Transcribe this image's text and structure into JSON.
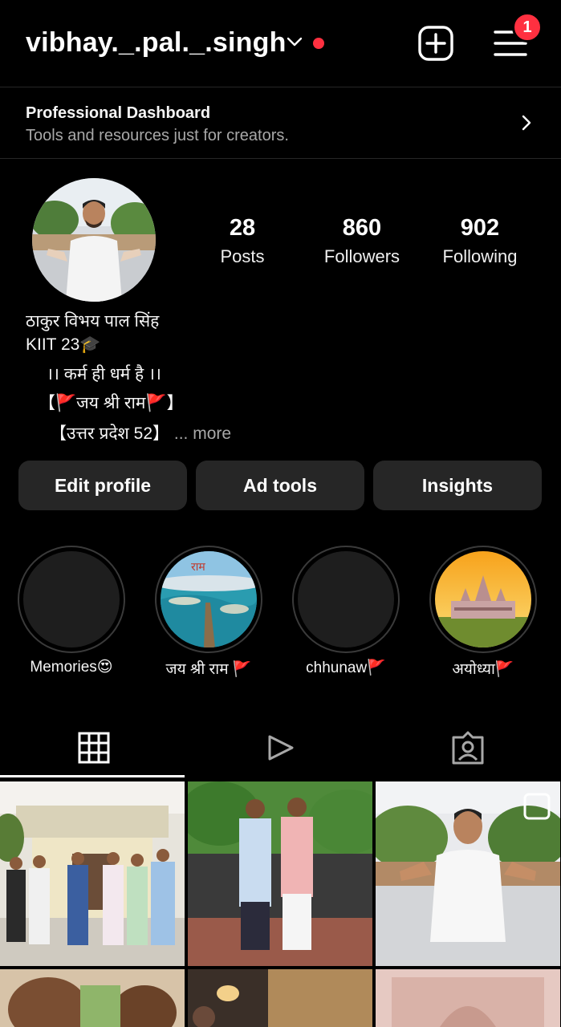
{
  "header": {
    "username": "vibhay._.pal._.singh",
    "notification_count": "1",
    "icons": [
      "chevron-down-icon",
      "create-plus-icon",
      "menu-icon"
    ],
    "colors": {
      "live_dot": "#ff3040",
      "badge": "#ff3040"
    }
  },
  "dashboard": {
    "title": "Professional Dashboard",
    "subtitle": "Tools and resources just for creators."
  },
  "profile": {
    "stats": [
      {
        "value": "28",
        "label": "Posts"
      },
      {
        "value": "860",
        "label": "Followers"
      },
      {
        "value": "902",
        "label": "Following"
      }
    ],
    "bio": {
      "line1": "ठाकुर विभय पाल सिंह",
      "line2": "KIIT 23🎓",
      "line3": "।। कर्म ही धर्म है ।।",
      "line4": "【🚩जय श्री राम🚩】",
      "line5": "【उत्तर प्रदेश 52】",
      "more": "... more"
    }
  },
  "actions": {
    "edit_profile": "Edit profile",
    "ad_tools": "Ad tools",
    "insights": "Insights"
  },
  "highlights": [
    {
      "label": "Memories😍"
    },
    {
      "label": "जय श्री राम 🚩"
    },
    {
      "label": "chhunaw🚩"
    },
    {
      "label": "अयोध्या🚩"
    }
  ],
  "tabs": [
    "grid-icon",
    "reels-icon",
    "tagged-icon"
  ]
}
